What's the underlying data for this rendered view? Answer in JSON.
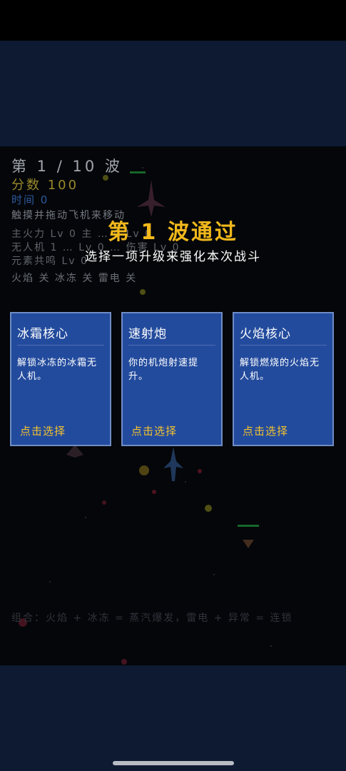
{
  "hud": {
    "wave": "第 1 / 10 波",
    "score": "分数 100",
    "time": "时间 0",
    "hint": "触摸并拖动飞机来移动",
    "weapons_line1": "主火力 Lv 0   主 … 0 Lv 0",
    "weapons_line2": "无人机 1   … Lv 0  … 伤害 Lv 0",
    "weapons_line3": "元素共鸣 Lv 0",
    "elements": "火焰 关   冰冻 关   雷电 关",
    "combo": "组合：火焰 + 冰冻 = 蒸汽爆发，雷电 + 异常 = 连锁"
  },
  "overlay": {
    "title": "第 1 波通过",
    "subtitle": "选择一项升级来强化本次战斗"
  },
  "cards": [
    {
      "title": "冰霜核心",
      "desc": "解锁冰冻的冰霜无人机。",
      "action": "点击选择"
    },
    {
      "title": "速射炮",
      "desc": "你的机炮射速提升。",
      "action": "点击选择"
    },
    {
      "title": "火焰核心",
      "desc": "解锁燃烧的火焰无人机。",
      "action": "点击选择"
    }
  ],
  "colors": {
    "card_bg": "#234b9d",
    "title_gold": "#f2b81c",
    "action_gold": "#f2c230",
    "health_bar": "#1f8a3a"
  }
}
